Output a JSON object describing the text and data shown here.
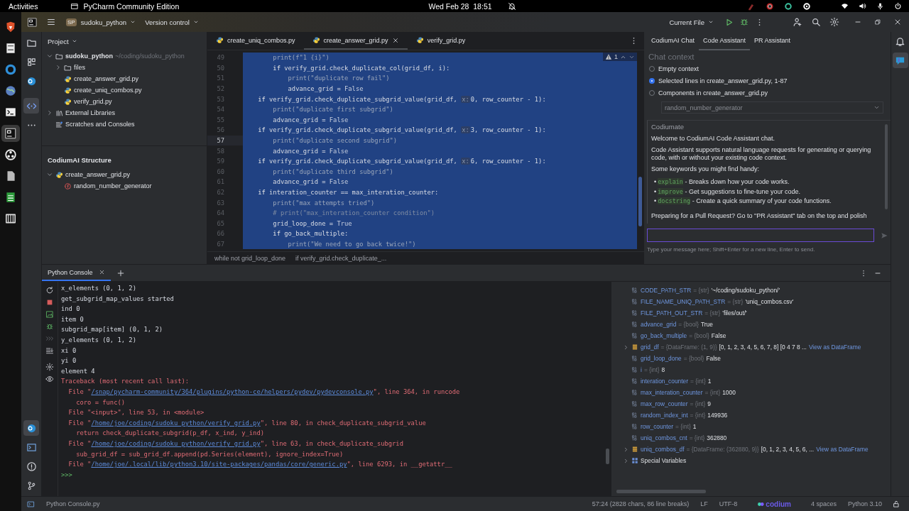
{
  "top_bar": {
    "activities": "Activities",
    "app": "PyCharm Community Edition",
    "clock": "Wed Feb 28  18:51"
  },
  "toolbar": {
    "project_badge": "SP",
    "project": "sudoku_python",
    "vcs": "Version control",
    "run_config": "Current File"
  },
  "project_panel": {
    "title": "Project",
    "tree": [
      {
        "label": "sudoku_python",
        "path": "~/coding/sudoku_python",
        "kind": "root",
        "expanded": true,
        "children": [
          {
            "label": "files",
            "kind": "folder",
            "expanded": false
          },
          {
            "label": "create_answer_grid.py",
            "kind": "py"
          },
          {
            "label": "create_uniq_combos.py",
            "kind": "py"
          },
          {
            "label": "verify_grid.py",
            "kind": "py"
          }
        ]
      },
      {
        "label": "External Libraries",
        "kind": "lib",
        "expanded": false
      },
      {
        "label": "Scratches and Consoles",
        "kind": "scratch"
      }
    ]
  },
  "structure_panel": {
    "title": "CodiumAI Structure",
    "tree": [
      {
        "label": "create_answer_grid.py",
        "kind": "py",
        "expanded": true,
        "children": [
          {
            "label": "random_number_generator",
            "kind": "func"
          }
        ]
      }
    ]
  },
  "editor": {
    "tabs": [
      {
        "label": "create_uniq_combos.py",
        "selected": false
      },
      {
        "label": "create_answer_grid.py",
        "selected": true
      },
      {
        "label": "verify_grid.py",
        "selected": false
      }
    ],
    "problems": "1",
    "lines": [
      {
        "num": "49",
        "current": false,
        "selected": true,
        "parts": [
          {
            "t": "        print(f\"1 {i}\")",
            "kind": "dim"
          }
        ]
      },
      {
        "num": "50",
        "current": false,
        "selected": true,
        "parts": [
          {
            "t": "        if",
            "kind": "kw"
          },
          {
            "t": " verify_grid.check_duplicate_col(grid_df, i):",
            "kind": "plain"
          }
        ]
      },
      {
        "num": "51",
        "current": false,
        "selected": true,
        "parts": [
          {
            "t": "            print(\"duplicate row fail\")",
            "kind": "dim"
          }
        ]
      },
      {
        "num": "52",
        "current": false,
        "selected": true,
        "parts": [
          {
            "t": "            advance_grid = ",
            "kind": "plain"
          },
          {
            "t": "False",
            "kind": "const"
          }
        ]
      },
      {
        "num": "53",
        "current": false,
        "selected": true,
        "parts": [
          {
            "t": "    if",
            "kind": "kw"
          },
          {
            "t": " verify_grid.check_duplicate_subgrid_value(grid_df, ",
            "kind": "plain"
          },
          {
            "t": "x:",
            "kind": "hint"
          },
          {
            "t": "0, row_counter - 1):",
            "kind": "plain"
          }
        ]
      },
      {
        "num": "54",
        "current": false,
        "selected": true,
        "parts": [
          {
            "t": "        print(\"duplicate first subgrid\")",
            "kind": "dim"
          }
        ]
      },
      {
        "num": "55",
        "current": false,
        "selected": true,
        "parts": [
          {
            "t": "        advance_grid = ",
            "kind": "plain"
          },
          {
            "t": "False",
            "kind": "const"
          }
        ]
      },
      {
        "num": "56",
        "current": false,
        "selected": true,
        "parts": [
          {
            "t": "    if",
            "kind": "kw"
          },
          {
            "t": " verify_grid.check_duplicate_subgrid_value(grid_df, ",
            "kind": "plain"
          },
          {
            "t": "x:",
            "kind": "hint"
          },
          {
            "t": "3, row_counter - 1):",
            "kind": "plain"
          }
        ]
      },
      {
        "num": "57",
        "current": true,
        "selected": true,
        "parts": [
          {
            "t": "        print(\"duplicate second subgrid\")",
            "kind": "dim"
          }
        ]
      },
      {
        "num": "58",
        "current": false,
        "selected": true,
        "parts": [
          {
            "t": "        advance_grid = ",
            "kind": "plain"
          },
          {
            "t": "False",
            "kind": "const"
          }
        ]
      },
      {
        "num": "59",
        "current": false,
        "selected": true,
        "parts": [
          {
            "t": "    if",
            "kind": "kw"
          },
          {
            "t": " verify_grid.check_duplicate_subgrid_value(grid_df, ",
            "kind": "plain"
          },
          {
            "t": "x:",
            "kind": "hint"
          },
          {
            "t": "6, row_counter - 1):",
            "kind": "plain"
          }
        ]
      },
      {
        "num": "60",
        "current": false,
        "selected": true,
        "parts": [
          {
            "t": "        print(\"duplicate third subgrid\")",
            "kind": "dim"
          }
        ]
      },
      {
        "num": "61",
        "current": false,
        "selected": true,
        "parts": [
          {
            "t": "        advance_grid = ",
            "kind": "plain"
          },
          {
            "t": "False",
            "kind": "const"
          }
        ]
      },
      {
        "num": "62",
        "current": false,
        "selected": true,
        "parts": [
          {
            "t": "    if",
            "kind": "kw"
          },
          {
            "t": " interation_counter == max_interation_counter:",
            "kind": "plain"
          }
        ]
      },
      {
        "num": "63",
        "current": false,
        "selected": true,
        "parts": [
          {
            "t": "        print(\"max attempts tried\")",
            "kind": "dim"
          }
        ]
      },
      {
        "num": "64",
        "current": false,
        "selected": true,
        "parts": [
          {
            "t": "        # print(\"max_interation_counter condition\")",
            "kind": "comment"
          }
        ]
      },
      {
        "num": "65",
        "current": false,
        "selected": true,
        "parts": [
          {
            "t": "        grid_loop_done = ",
            "kind": "plain"
          },
          {
            "t": "True",
            "kind": "const"
          }
        ]
      },
      {
        "num": "66",
        "current": false,
        "selected": true,
        "parts": [
          {
            "t": "        if",
            "kind": "kw"
          },
          {
            "t": " go_back_multiple:",
            "kind": "plain"
          }
        ]
      },
      {
        "num": "67",
        "current": false,
        "selected": true,
        "parts": [
          {
            "t": "            print(\"We need to go back twice!\")",
            "kind": "dim"
          }
        ]
      }
    ],
    "breadcrumbs": [
      "while not grid_loop_done",
      "if verify_grid.check_duplicate_..."
    ]
  },
  "chat": {
    "tabs": [
      {
        "label": "CodiumAI Chat",
        "selected": false
      },
      {
        "label": "Code Assistant",
        "selected": true
      },
      {
        "label": "PR Assistant",
        "selected": false
      }
    ],
    "context_title": "Chat context",
    "options": [
      {
        "label": "Empty context",
        "selected": false
      },
      {
        "label": "Selected lines in create_answer_grid.py, 1-87",
        "selected": true
      },
      {
        "label": "Components in create_answer_grid.py",
        "selected": false
      }
    ],
    "component_select": {
      "value": "random_number_generator",
      "disabled": true
    },
    "sender": "Codiumate",
    "blocks": [
      {
        "kind": "p",
        "text": "Welcome to CodiumAI Code Assistant chat."
      },
      {
        "kind": "p",
        "text": "Code Assistant supports natural language requests for generating or querying code, with or without your existing code context."
      },
      {
        "kind": "p",
        "text": "Some keywords you might find handy:"
      },
      {
        "kind": "list",
        "items": [
          {
            "bullet": "•",
            "keyword": "explain",
            "text": " - Breaks down how your code works."
          },
          {
            "bullet": "•",
            "keyword": "improve",
            "text": " - Get suggestions to fine-tune your code."
          },
          {
            "bullet": "•",
            "keyword": "docstring",
            "text": " - Create a quick summary of your code functions."
          }
        ]
      },
      {
        "kind": "p",
        "text": "Preparing for a Pull Request? Go to \"PR Assistant\" tab on the top and polish"
      }
    ],
    "input": {
      "focused": true
    },
    "input_hint": "Type your message here; Shift+Enter for a new line, Enter to send."
  },
  "console": {
    "tab": "Python Console",
    "lines": [
      {
        "kind": "out",
        "parts": [
          {
            "t": "x_elements (0, 1, 2)",
            "kind": "text"
          }
        ]
      },
      {
        "kind": "out",
        "parts": [
          {
            "t": "get_subgrid_map_values started",
            "kind": "text"
          }
        ]
      },
      {
        "kind": "out",
        "parts": [
          {
            "t": "ind 0",
            "kind": "text"
          }
        ]
      },
      {
        "kind": "out",
        "parts": [
          {
            "t": "item 0",
            "kind": "text"
          }
        ]
      },
      {
        "kind": "out",
        "parts": [
          {
            "t": "subgrid_map[item] (0, 1, 2)",
            "kind": "text"
          }
        ]
      },
      {
        "kind": "out",
        "parts": [
          {
            "t": "y_elements (0, 1, 2)",
            "kind": "text"
          }
        ]
      },
      {
        "kind": "out",
        "parts": [
          {
            "t": "xi 0",
            "kind": "text"
          }
        ]
      },
      {
        "kind": "out",
        "parts": [
          {
            "t": "yi 0",
            "kind": "text"
          }
        ]
      },
      {
        "kind": "out",
        "parts": [
          {
            "t": "element 4",
            "kind": "text"
          }
        ]
      },
      {
        "kind": "err",
        "parts": [
          {
            "t": "Traceback (most recent call last):",
            "kind": "text"
          }
        ]
      },
      {
        "kind": "err",
        "parts": [
          {
            "t": "  File \"",
            "kind": "text"
          },
          {
            "t": "/snap/pycharm-community/364/plugins/python-ce/helpers/pydev/pydevconsole.py",
            "kind": "link"
          },
          {
            "t": "\", line 364, in runcode",
            "kind": "text"
          }
        ]
      },
      {
        "kind": "err",
        "parts": [
          {
            "t": "    coro = func()",
            "kind": "text"
          }
        ]
      },
      {
        "kind": "err",
        "parts": [
          {
            "t": "  File \"<input>\", line 53, in <module>",
            "kind": "text"
          }
        ]
      },
      {
        "kind": "err",
        "parts": [
          {
            "t": "  File \"",
            "kind": "text"
          },
          {
            "t": "/home/joe/coding/sudoku_python/verify_grid.py",
            "kind": "link"
          },
          {
            "t": "\", line 80, in check_duplicate_subgrid_value",
            "kind": "text"
          }
        ]
      },
      {
        "kind": "err",
        "parts": [
          {
            "t": "    return check_duplicate_subgrid(p_df, x_ind, y_ind)",
            "kind": "text"
          }
        ]
      },
      {
        "kind": "err",
        "parts": [
          {
            "t": "  File \"",
            "kind": "text"
          },
          {
            "t": "/home/joe/coding/sudoku_python/verify_grid.py",
            "kind": "link"
          },
          {
            "t": "\", line 63, in check_duplicate_subgrid",
            "kind": "text"
          }
        ]
      },
      {
        "kind": "err",
        "parts": [
          {
            "t": "    sub_grid_df = sub_grid_df.append(pd.Series(element), ignore_index=True)",
            "kind": "text"
          }
        ]
      },
      {
        "kind": "err",
        "parts": [
          {
            "t": "  File \"",
            "kind": "text"
          },
          {
            "t": "/home/joe/.local/lib/python3.10/site-packages/pandas/core/generic.py",
            "kind": "link"
          },
          {
            "t": "\", line 6293, in __getattr__",
            "kind": "text"
          }
        ]
      },
      {
        "kind": "prompt",
        "parts": [
          {
            "t": ">>>",
            "kind": "text"
          }
        ]
      }
    ]
  },
  "variables": [
    {
      "kind": "var",
      "name": "CODE_PATH_STR",
      "type": "= {str}",
      "value": "'~/coding/sudoku_python/'"
    },
    {
      "kind": "var",
      "name": "FILE_NAME_UNIQ_PATH_STR",
      "type": "= {str}",
      "value": "'uniq_combos.csv'"
    },
    {
      "kind": "var",
      "name": "FILE_PATH_OUT_STR",
      "type": "= {str}",
      "value": "'files/out/'"
    },
    {
      "kind": "var",
      "name": "advance_grid",
      "type": "= {bool}",
      "value": "True"
    },
    {
      "kind": "var",
      "name": "go_back_multiple",
      "type": "= {bool}",
      "value": "False"
    },
    {
      "kind": "frame",
      "name": "grid_df",
      "type": "= {DataFrame: (1, 9)}",
      "value": "[0, 1, 2, 3, 4, 5, 6, 7, 8] [0  4  7  8 ...",
      "link": "View as DataFrame",
      "expanded": false
    },
    {
      "kind": "var",
      "name": "grid_loop_done",
      "type": "= {bool}",
      "value": "False"
    },
    {
      "kind": "var",
      "name": "i",
      "type": "= {int}",
      "value": "8"
    },
    {
      "kind": "var",
      "name": "interation_counter",
      "type": "= {int}",
      "value": "1"
    },
    {
      "kind": "var",
      "name": "max_interation_counter",
      "type": "= {int}",
      "value": "1000"
    },
    {
      "kind": "var",
      "name": "max_row_counter",
      "type": "= {int}",
      "value": "9"
    },
    {
      "kind": "var",
      "name": "random_index_int",
      "type": "= {int}",
      "value": "149936"
    },
    {
      "kind": "var",
      "name": "row_counter",
      "type": "= {int}",
      "value": "1"
    },
    {
      "kind": "var",
      "name": "uniq_combos_cnt",
      "type": "= {int}",
      "value": "362880"
    },
    {
      "kind": "frame",
      "name": "uniq_combos_df",
      "type": "= {DataFrame: (362880, 9)}",
      "value": "[0, 1, 2, 3, 4, 5, 6, ...",
      "link": "View as DataFrame",
      "expanded": false
    },
    {
      "kind": "special",
      "name": "Special Variables",
      "expanded": false
    }
  ],
  "status_bar": {
    "file": "Python Console.py",
    "position": "57:24 (2828 chars, 86 line breaks)",
    "line_sep": "LF",
    "encoding": "UTF-8",
    "plugin": "codium",
    "indent": "4 spaces",
    "interpreter": "Python 3.10"
  }
}
